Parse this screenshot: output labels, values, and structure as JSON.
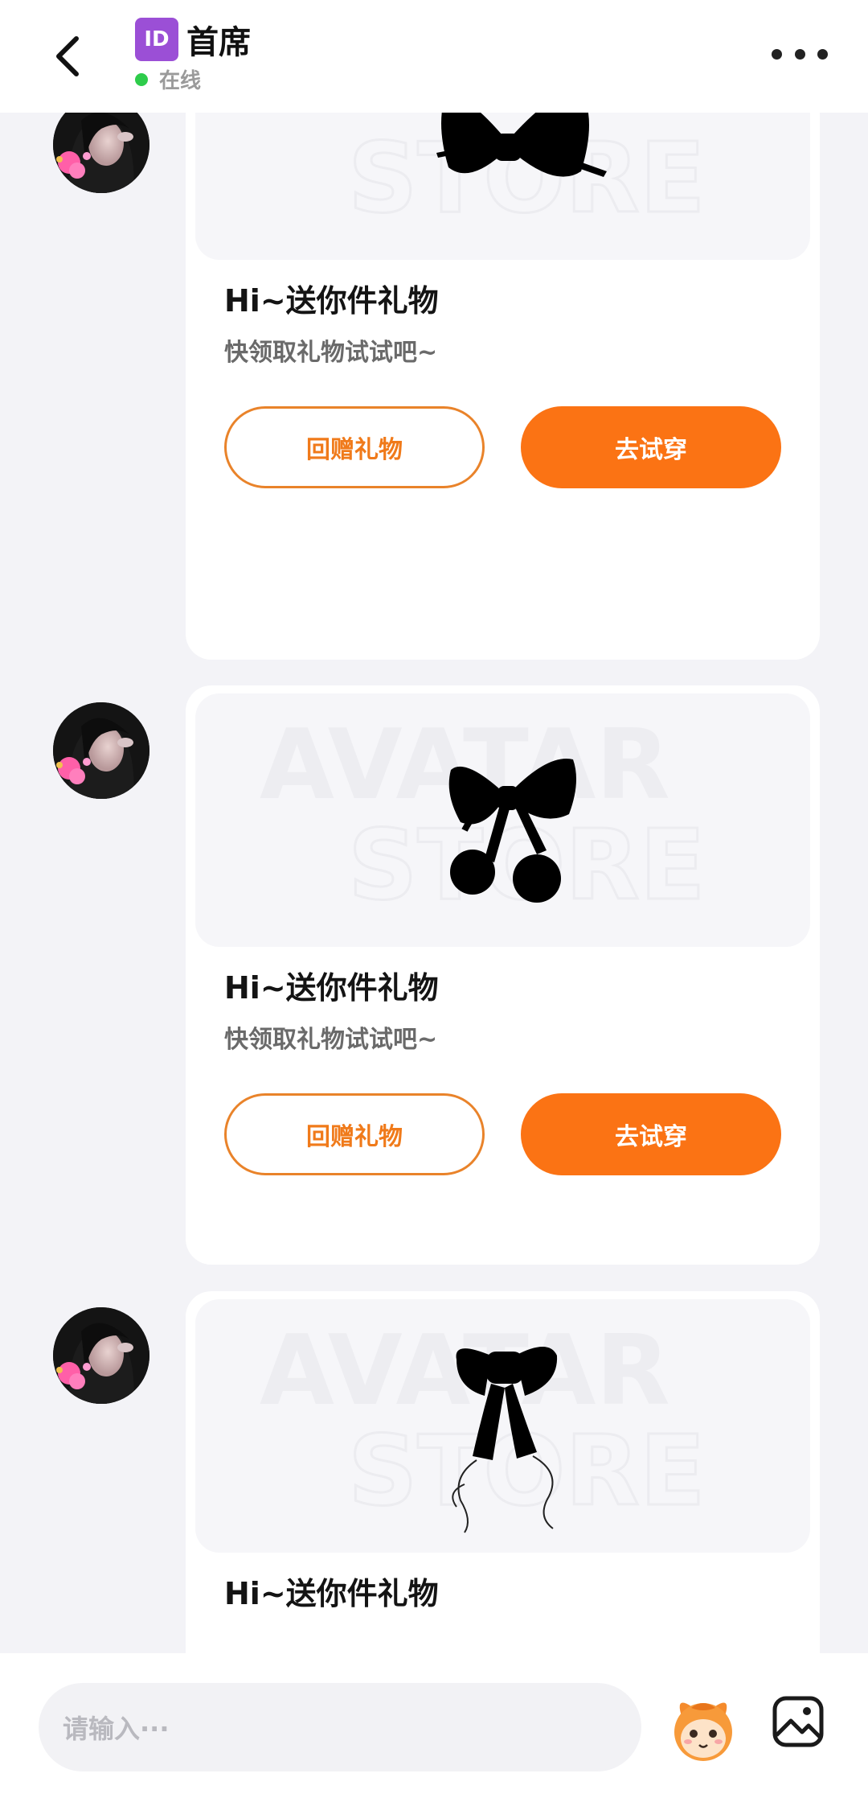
{
  "header": {
    "id_badge": "ID",
    "title": "首席",
    "status": "在线",
    "status_color": "#2ecc4b"
  },
  "messages": [
    {
      "gift_icon": "bow-icon",
      "title": "Hi~送你件礼物",
      "subtitle": "快领取礼物试试吧~",
      "gift_back_label": "回赠礼物",
      "try_on_label": "去试穿"
    },
    {
      "gift_icon": "cherry-bow-icon",
      "title": "Hi~送你件礼物",
      "subtitle": "快领取礼物试试吧~",
      "gift_back_label": "回赠礼物",
      "try_on_label": "去试穿"
    },
    {
      "gift_icon": "ribbon-bow-icon",
      "title": "Hi~送你件礼物"
    }
  ],
  "watermark": [
    "AVATAR",
    "STORE"
  ],
  "input": {
    "placeholder": "请输入···"
  },
  "colors": {
    "accent": "#fb7314",
    "accent_outline": "#e9832a"
  }
}
